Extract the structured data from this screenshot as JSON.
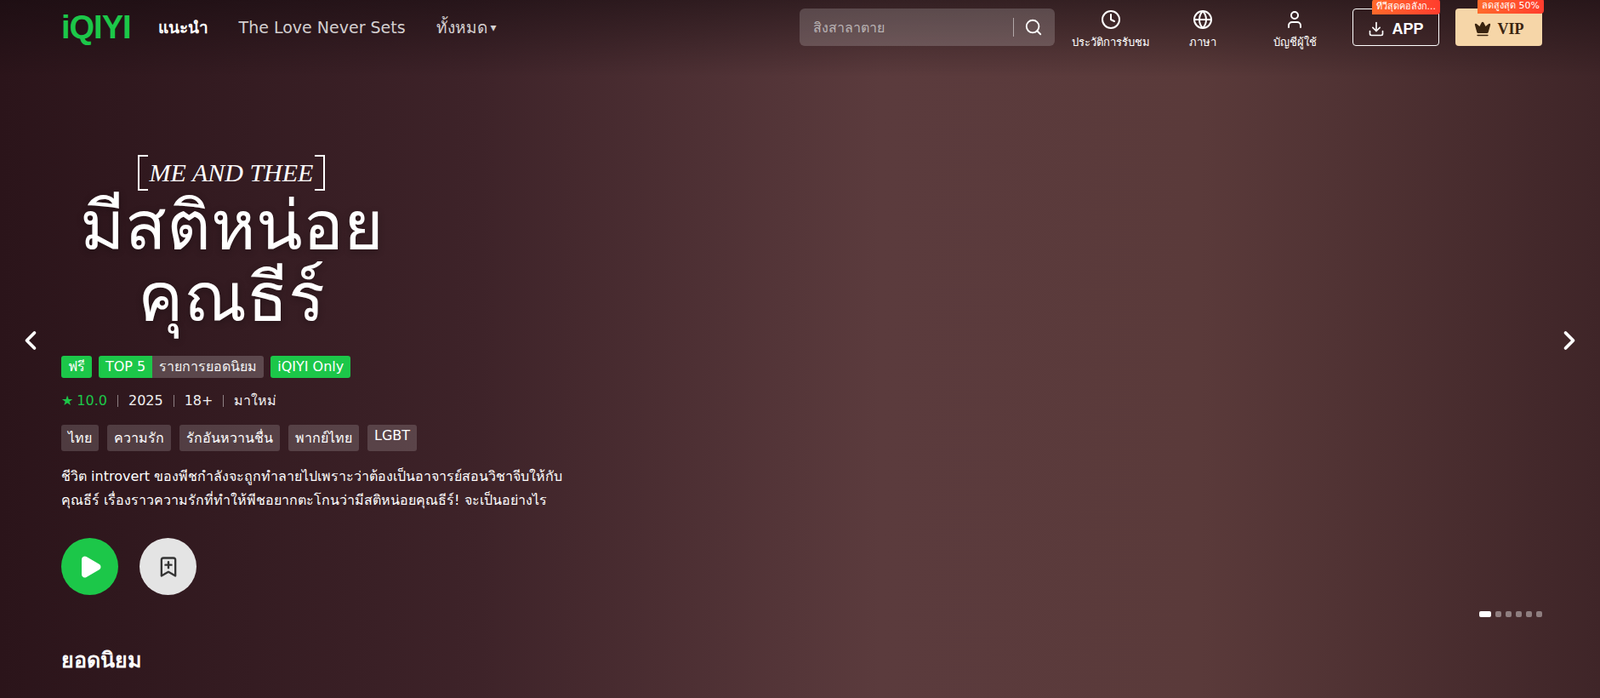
{
  "header": {
    "logo": "iQIYI",
    "nav": [
      {
        "label": "แนะนำ",
        "selected": true,
        "kind": "link"
      },
      {
        "label": "The Love Never Sets",
        "selected": false,
        "kind": "link"
      },
      {
        "label": "ทั้งหมด",
        "selected": false,
        "kind": "dropdown",
        "caret": "▾"
      }
    ],
    "search": {
      "placeholder": "สิงสาลาตาย"
    },
    "actions": [
      {
        "label": "ประวัติการรับชม"
      },
      {
        "label": "ภาษา"
      },
      {
        "label": "บัญชีผู้ใช้"
      }
    ],
    "app": {
      "label": "APP",
      "badge": "ทีวีสุดคอลังก..."
    },
    "vip": {
      "label": "VIP",
      "badge": "ลดสูงสุด 50%"
    }
  },
  "hero": {
    "subtitle": "ME AND THEE",
    "title_lines": [
      "มีสติหน่อย",
      "คุณธีร์"
    ],
    "badges": [
      {
        "text": "ฟรี",
        "kind": "free"
      },
      {
        "text": "TOP 5",
        "kind": "rank",
        "detail": "รายการยอดนิยม"
      },
      {
        "text": "iQIYI Only",
        "kind": "exclusive"
      }
    ],
    "meta": {
      "star": "★",
      "rating": "10.0",
      "items": [
        "2025",
        "18+",
        "มาใหม่"
      ]
    },
    "genres": [
      "ไทย",
      "ความรัก",
      "รักอันหวานชื่น",
      "พากย์ไทย",
      "LGBT"
    ],
    "description": "ชีวิต introvert ของพีชกำลังจะถูกทำลายไปเพราะว่าต้องเป็นอาจารย์สอนวิชาจีบให้กับคุณธีร์ เรื่องราวความรักที่ทำให้พีชอยากตะโกนว่ามีสติหน่อยคุณธีร์! จะเป็นอย่างไร",
    "slides": [
      {
        "selected": true
      },
      {
        "selected": false
      },
      {
        "selected": false
      },
      {
        "selected": false
      },
      {
        "selected": false
      },
      {
        "selected": false
      }
    ]
  },
  "section": {
    "title": "ยอดนิยม"
  }
}
